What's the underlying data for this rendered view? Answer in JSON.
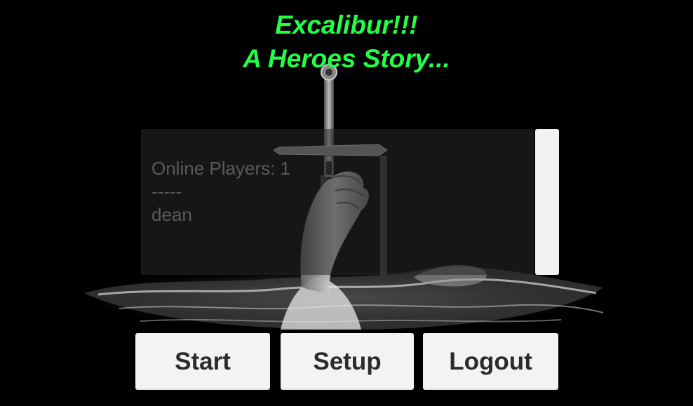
{
  "game": {
    "title_line1": "Excalibur!!!",
    "title_line2": "A Heroes Story..."
  },
  "players": {
    "heading": "Online Players: 1",
    "separator": "-----",
    "list": [
      "dean"
    ]
  },
  "buttons": {
    "start": "Start",
    "setup": "Setup",
    "logout": "Logout"
  },
  "colors": {
    "title": "#22ff44",
    "background": "#000000",
    "button_bg": "#f3f3f3",
    "button_text": "#2b2b2b"
  },
  "art": {
    "icon": "excalibur-sword-in-lake-artwork"
  }
}
